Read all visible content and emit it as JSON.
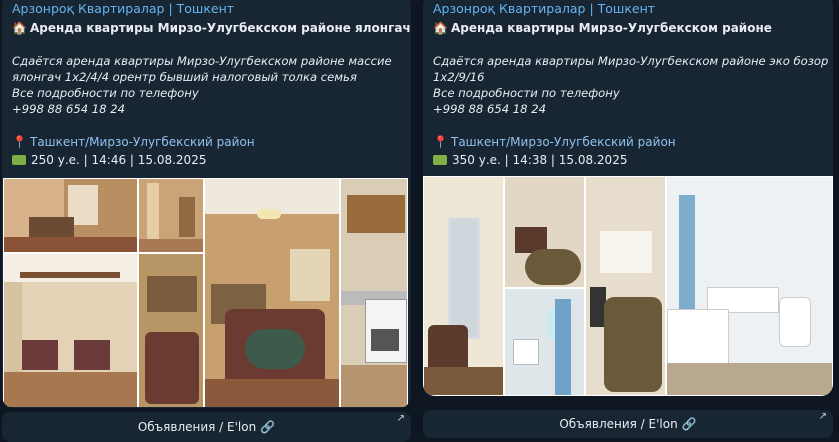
{
  "posts": [
    {
      "channel": "Арзонроқ Квартиралар | Тошкент",
      "title_emoji": "house-icon",
      "title": "Аренда квартиры Мирзо-Улугбекском районе  ялонгач",
      "description_lines": [
        "Сдаётся аренда квартиры Мирзо-Улугбекском районе массие",
        "ялонгач 1х2/4/4 орентр бывший налоговый толка семья",
        "Все подробности по телефону",
        "+998 88 654 18 24"
      ],
      "location": "Ташкент/Мирзо-Улугбекский район",
      "price_line": "250 у.е. | 14:46 | 15.08.2025",
      "footer": "Объявления / E'lon",
      "colors": {
        "wall": "#c69b69",
        "floor": "#7a4f3a",
        "rug": "#6b3b32"
      }
    },
    {
      "channel": "Арзонроқ Квартиралар | Тошкент",
      "title_emoji": "house-icon",
      "title": "Аренда квартиры Мирзо-Улугбекском районе",
      "description_lines": [
        "Сдаётся аренда квартиры Мирзо-Улугбекском районе эко бозор",
        "1х2/9/16",
        "Все подробности по телефону",
        "+998 88 654 18 24"
      ],
      "location": "Ташкент/Мирзо-Улугбекский район",
      "price_line": "350 у.е. | 14:38 | 15.08.2025",
      "footer": "Объявления / E'lon",
      "colors": {
        "wall": "#e8dcc7",
        "floor": "#6f5a3a",
        "tile": "#e9eef2"
      }
    }
  ]
}
